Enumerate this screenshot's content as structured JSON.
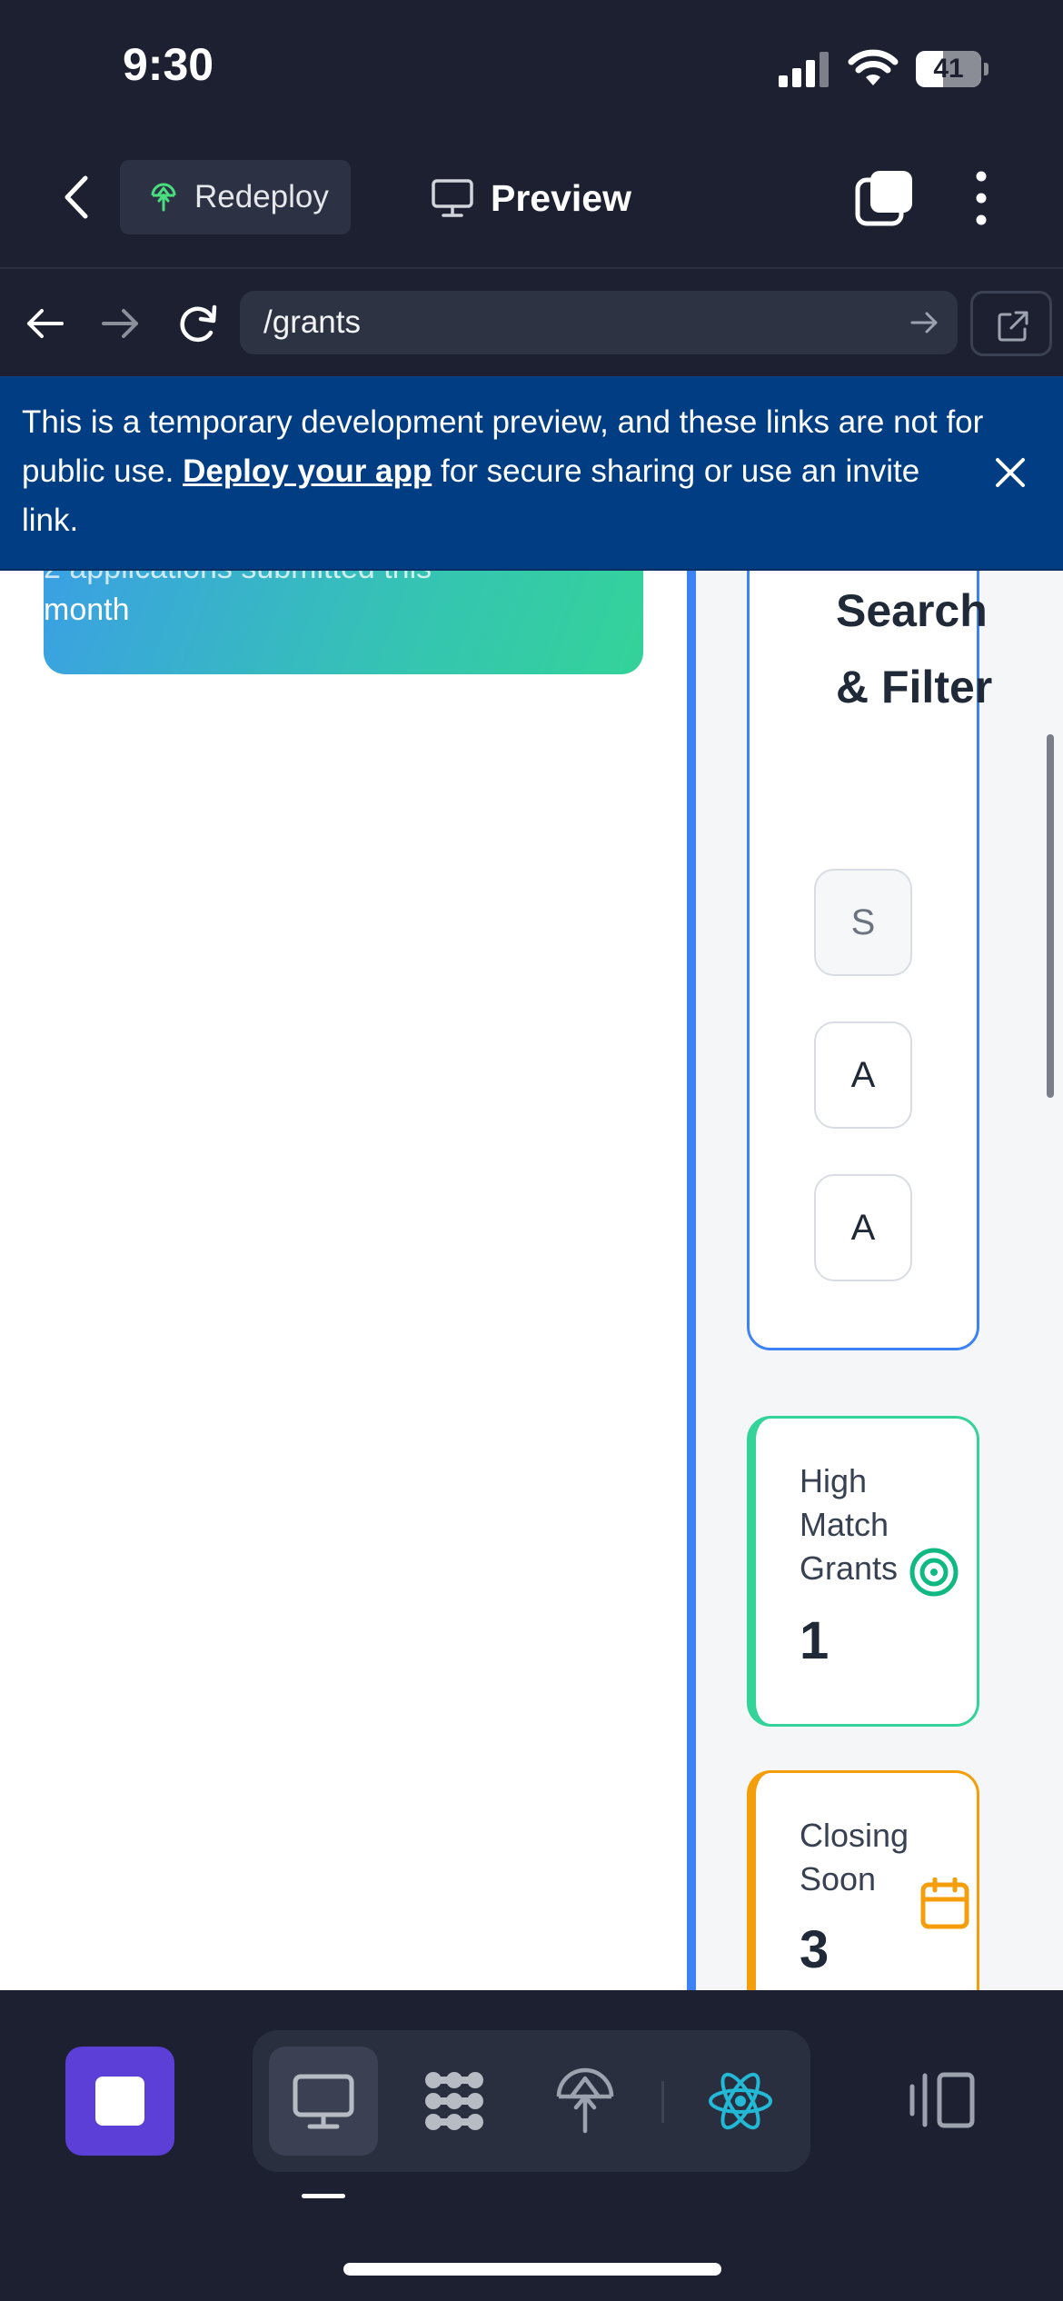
{
  "status_bar": {
    "time": "9:30",
    "battery": "41"
  },
  "header": {
    "redeploy_label": "Redeploy",
    "preview_label": "Preview"
  },
  "browser": {
    "url": "/grants"
  },
  "banner": {
    "text_before": "This is a temporary development preview, and these links are not for public use. ",
    "link_text": "Deploy your app",
    "text_after": " for secure sharing or use an invite link."
  },
  "page": {
    "gradient_card": {
      "faded_line": "2 applications submitted this",
      "text": "month"
    },
    "search_filter": {
      "title": "Search & Filter",
      "buttons": [
        "S",
        "A",
        "A"
      ]
    },
    "stats": [
      {
        "label": "High Match Grants",
        "value": "1",
        "icon": "target-icon"
      },
      {
        "label": "Closing Soon",
        "value": "3",
        "icon": "calendar-icon"
      }
    ]
  },
  "colors": {
    "chrome_bg": "#1c2030",
    "banner_bg": "#003d82",
    "accent_blue": "#3b82f6",
    "accent_green": "#34d399",
    "accent_orange": "#f59e0b",
    "stop_button": "#5b3fd6",
    "react_icon": "#22b8d6"
  },
  "bottom_toolbar": {
    "tools": [
      "stop-icon",
      "desktop-icon",
      "dots-icon",
      "deploy-icon",
      "react-icon",
      "panel-icon"
    ]
  }
}
